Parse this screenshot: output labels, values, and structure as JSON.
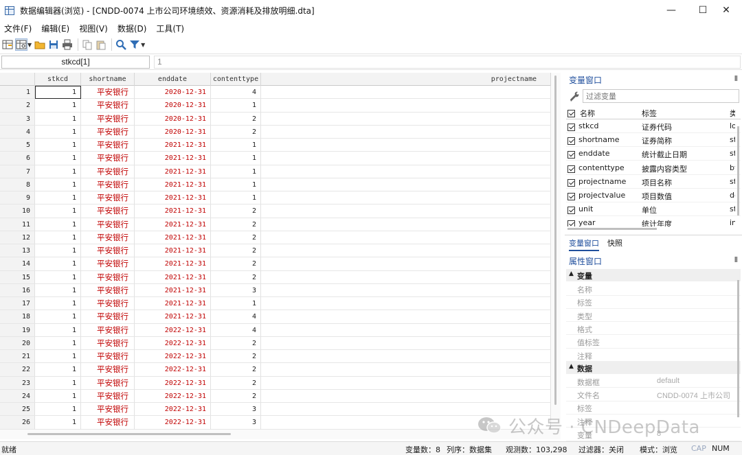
{
  "window": {
    "title": "数据编辑器(浏览) - [CNDD-0074 上市公司环境绩效、资源消耗及排放明细.dta]",
    "minimize": "—",
    "maximize": "☐",
    "close": "✕"
  },
  "menu": [
    "文件(F)",
    "编辑(E)",
    "视图(V)",
    "数据(D)",
    "工具(T)"
  ],
  "toolbar": [
    "data-editor-edit-icon",
    "data-editor-browse-icon",
    "open-folder-icon",
    "save-icon",
    "print-icon",
    "copy-icon",
    "paste-icon",
    "search-icon",
    "filter-icon"
  ],
  "cellbar": {
    "name": "stkcd[1]",
    "value": "1"
  },
  "grid": {
    "columns": [
      "stkcd",
      "shortname",
      "enddate",
      "contenttype",
      "projectname"
    ],
    "rows": [
      [
        "1",
        "1",
        "平安银行",
        "2020-12-31",
        "4"
      ],
      [
        "2",
        "1",
        "平安银行",
        "2020-12-31",
        "1"
      ],
      [
        "3",
        "1",
        "平安银行",
        "2020-12-31",
        "2"
      ],
      [
        "4",
        "1",
        "平安银行",
        "2020-12-31",
        "2"
      ],
      [
        "5",
        "1",
        "平安银行",
        "2021-12-31",
        "1"
      ],
      [
        "6",
        "1",
        "平安银行",
        "2021-12-31",
        "1"
      ],
      [
        "7",
        "1",
        "平安银行",
        "2021-12-31",
        "1"
      ],
      [
        "8",
        "1",
        "平安银行",
        "2021-12-31",
        "1"
      ],
      [
        "9",
        "1",
        "平安银行",
        "2021-12-31",
        "1"
      ],
      [
        "10",
        "1",
        "平安银行",
        "2021-12-31",
        "2"
      ],
      [
        "11",
        "1",
        "平安银行",
        "2021-12-31",
        "2"
      ],
      [
        "12",
        "1",
        "平安银行",
        "2021-12-31",
        "2"
      ],
      [
        "13",
        "1",
        "平安银行",
        "2021-12-31",
        "2"
      ],
      [
        "14",
        "1",
        "平安银行",
        "2021-12-31",
        "2"
      ],
      [
        "15",
        "1",
        "平安银行",
        "2021-12-31",
        "2"
      ],
      [
        "16",
        "1",
        "平安银行",
        "2021-12-31",
        "3"
      ],
      [
        "17",
        "1",
        "平安银行",
        "2021-12-31",
        "1"
      ],
      [
        "18",
        "1",
        "平安银行",
        "2021-12-31",
        "4"
      ],
      [
        "19",
        "1",
        "平安银行",
        "2022-12-31",
        "4"
      ],
      [
        "20",
        "1",
        "平安银行",
        "2022-12-31",
        "2"
      ],
      [
        "21",
        "1",
        "平安银行",
        "2022-12-31",
        "2"
      ],
      [
        "22",
        "1",
        "平安银行",
        "2022-12-31",
        "2"
      ],
      [
        "23",
        "1",
        "平安银行",
        "2022-12-31",
        "2"
      ],
      [
        "24",
        "1",
        "平安银行",
        "2022-12-31",
        "2"
      ],
      [
        "25",
        "1",
        "平安银行",
        "2022-12-31",
        "3"
      ],
      [
        "26",
        "1",
        "平安银行",
        "2022-12-31",
        "3"
      ]
    ]
  },
  "variables_panel": {
    "title": "变量窗口",
    "pin": "Ⅱ",
    "filter_placeholder": "过滤变量",
    "headers": [
      "名称",
      "标签",
      "类"
    ],
    "items": [
      {
        "name": "stkcd",
        "label": "证券代码",
        "type": "lo"
      },
      {
        "name": "shortname",
        "label": "证券简称",
        "type": "st"
      },
      {
        "name": "enddate",
        "label": "统计截止日期",
        "type": "st"
      },
      {
        "name": "contenttype",
        "label": "披露内容类型",
        "type": "by"
      },
      {
        "name": "projectname",
        "label": "项目名称",
        "type": "st"
      },
      {
        "name": "projectvalue",
        "label": "项目数值",
        "type": "do"
      },
      {
        "name": "unit",
        "label": "单位",
        "type": "st"
      },
      {
        "name": "year",
        "label": "统计年度",
        "type": "in"
      }
    ],
    "tabs": [
      "变量窗口",
      "快照"
    ]
  },
  "properties_panel": {
    "title": "属性窗口",
    "pin": "Ⅱ",
    "sections": [
      {
        "title": "变量",
        "rows": [
          {
            "key": "名称",
            "value": ""
          },
          {
            "key": "标签",
            "value": ""
          },
          {
            "key": "类型",
            "value": ""
          },
          {
            "key": "格式",
            "value": ""
          },
          {
            "key": "值标签",
            "value": ""
          },
          {
            "key": "注释",
            "value": ""
          }
        ]
      },
      {
        "title": "数据",
        "rows": [
          {
            "key": "数据框",
            "value": "default"
          },
          {
            "key": "文件名",
            "value": "CNDD-0074 上市公司"
          },
          {
            "key": "标签",
            "value": ""
          },
          {
            "key": "注释",
            "value": ""
          },
          {
            "key": "变量",
            "value": "8"
          }
        ]
      }
    ]
  },
  "statusbar": {
    "ready": "就绪",
    "vars": "变量数：8",
    "order": "列序：数据集",
    "obs": "观测数：103,298",
    "filter": "过滤器：关闭",
    "mode": "模式：浏览",
    "cap": "CAP",
    "num": "NUM"
  },
  "watermark": {
    "text": "公众号 · CNDeepData"
  },
  "colors": {
    "accent": "#1f4e9c",
    "string_cell": "#c00000"
  }
}
